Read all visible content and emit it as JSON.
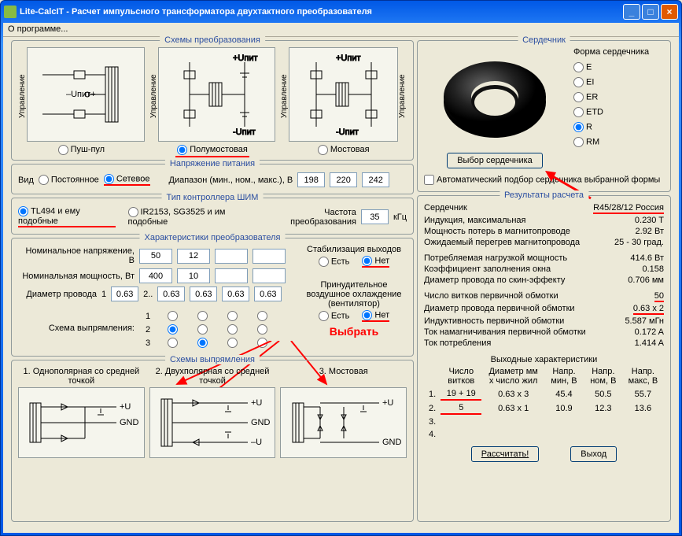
{
  "window": {
    "title": "Lite-CalcIT - Расчет импульсного трансформатора двухтактного преобразователя"
  },
  "menu": {
    "about": "О программе..."
  },
  "groups": {
    "schemes": "Схемы  преобразования",
    "voltage": "Напряжение питания",
    "controller": "Тип контроллера ШИМ",
    "params": "Характеристики преобразователя",
    "rectify": "Схемы выпрямления",
    "core": "Сердечник",
    "results": "Результаты расчета"
  },
  "schemes": {
    "ctrl_label": "Управление",
    "upit": "+Uпит",
    "minus_upit": "-Uпит",
    "upit_plus": "–Uпит+",
    "items": [
      {
        "label": "Пуш-пул"
      },
      {
        "label": "Полумостовая"
      },
      {
        "label": "Мостовая"
      }
    ]
  },
  "voltage": {
    "kind_label": "Вид",
    "const": "Постоянное",
    "ac": "Сетевое",
    "range_label": "Диапазон (мин., ном., макс.), В",
    "min": "198",
    "nom": "220",
    "max": "242"
  },
  "controller": {
    "tl494": "TL494 и ему подобные",
    "ir2153": "IR2153, SG3525 и им подобные",
    "freq_label": "Частота преобразования",
    "freq": "35",
    "freq_unit": "кГц"
  },
  "params": {
    "volt_label": "Номинальное напряжение, В",
    "power_label": "Номинальная мощность, Вт",
    "wire_label": "Диаметр провода",
    "rect_label": "Схема выпрямления:",
    "stab_label": "Стабилизация выходов",
    "yes": "Есть",
    "no": "Нет",
    "cool_label": "Принудительное воздушное охлаждение (вентилятор)",
    "select": "Выбрать",
    "v1": "50",
    "v2": "12",
    "p1": "400",
    "p2": "10",
    "d0": "0.63",
    "d1": "0.63",
    "d2": "0.63",
    "d3": "0.63",
    "d4": "0.63",
    "row_labels": [
      "1",
      "2",
      "3"
    ]
  },
  "rectify_schemes": {
    "items": [
      {
        "title": "1. Однополярная со средней точкой"
      },
      {
        "title": "2. Двухполярная со средней точкой"
      },
      {
        "title": "3. Мостовая"
      }
    ],
    "plus_u": "+U",
    "minus_u": "–U",
    "gnd": "GND"
  },
  "core": {
    "select_btn": "Выбор сердечника",
    "auto": "Автоматический подбор сердечника выбранной формы",
    "shape_label": "Форма сердечника",
    "shapes": [
      "E",
      "EI",
      "ER",
      "ETD",
      "R",
      "RM"
    ]
  },
  "results": {
    "core_label": "Сердечник",
    "core_val": "R45/28/12 Россия",
    "b_label": "Индукция, максимальная",
    "b_val": "0.230 T",
    "loss_label": "Мощность потерь в магнитопроводе",
    "loss_val": "2.92 Вт",
    "heat_label": "Ожидаемый перегрев магнитопровода",
    "heat_val": "25 - 30 град.",
    "load_label": "Потребляемая нагрузкой мощность",
    "load_val": "414.6 Вт",
    "fill_label": "Коэффициент заполнения окна",
    "fill_val": "0.158",
    "skin_label": "Диаметр провода по скин-эффекту",
    "skin_val": "0.706 мм",
    "turns_label": "Число витков первичной обмотки",
    "turns_val": "50",
    "pwire_label": "Диаметр провода первичной обмотки",
    "pwire_val": "0.63 x 2",
    "ind_label": "Индуктивность первичной обмотки",
    "ind_val": "5.587 мГн",
    "imag_label": "Ток намагничивания первичной обмотки",
    "imag_val": "0.172 A",
    "icon_label": "Ток потребления",
    "icon_val": "1.414 A",
    "out_title": "Выходные характеристики",
    "out_headers": [
      "",
      "Число витков",
      "Диаметр мм x число жил",
      "Напр. мин, В",
      "Напр. ном, В",
      "Напр. макс, В"
    ],
    "out_rows": [
      [
        "1.",
        "19 + 19",
        "0.63 x 3",
        "45.4",
        "50.5",
        "55.7"
      ],
      [
        "2.",
        "5",
        "0.63 x 1",
        "10.9",
        "12.3",
        "13.6"
      ],
      [
        "3.",
        "",
        "",
        "",
        "",
        ""
      ],
      [
        "4.",
        "",
        "",
        "",
        "",
        ""
      ]
    ]
  },
  "buttons": {
    "calc": "Рассчитать!",
    "exit": "Выход"
  }
}
